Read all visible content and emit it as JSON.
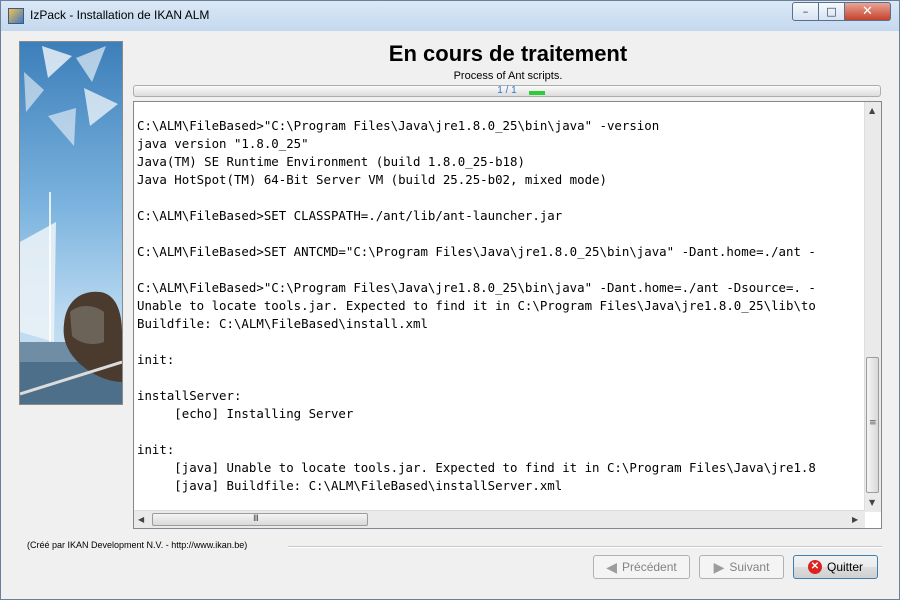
{
  "window": {
    "title": "IzPack - Installation de IKAN ALM",
    "minimize_glyph": "–",
    "maximize_glyph": "□",
    "close_glyph": "✕"
  },
  "panel": {
    "title": "En cours de traitement",
    "subtitle": "Process of Ant scripts."
  },
  "progress": {
    "label": "1 / 1",
    "value": 1,
    "max": 1
  },
  "output": {
    "lines": [
      "C:\\ALM\\FileBased>\"C:\\Program Files\\Java\\jre1.8.0_25\\bin\\java\" -version",
      "java version \"1.8.0_25\"",
      "Java(TM) SE Runtime Environment (build 1.8.0_25-b18)",
      "Java HotSpot(TM) 64-Bit Server VM (build 25.25-b02, mixed mode)",
      "",
      "C:\\ALM\\FileBased>SET CLASSPATH=./ant/lib/ant-launcher.jar",
      "",
      "C:\\ALM\\FileBased>SET ANTCMD=\"C:\\Program Files\\Java\\jre1.8.0_25\\bin\\java\" -Dant.home=./ant -",
      "",
      "C:\\ALM\\FileBased>\"C:\\Program Files\\Java\\jre1.8.0_25\\bin\\java\" -Dant.home=./ant -Dsource=. -",
      "Unable to locate tools.jar. Expected to find it in C:\\Program Files\\Java\\jre1.8.0_25\\lib\\to",
      "Buildfile: C:\\ALM\\FileBased\\install.xml",
      "",
      "init:",
      "",
      "installServer:",
      "     [echo] Installing Server",
      "",
      "init:",
      "     [java] Unable to locate tools.jar. Expected to find it in C:\\Program Files\\Java\\jre1.8",
      "     [java] Buildfile: C:\\ALM\\FileBased\\installServer.xml"
    ],
    "hscroll_grip": "III",
    "vscroll_grip": "≡"
  },
  "footer": {
    "credit": "(Créé par IKAN Development N.V. - http://www.ikan.be)"
  },
  "buttons": {
    "previous": {
      "label": "Précédent",
      "icon": "arrow-left-icon",
      "state": "disabled"
    },
    "next": {
      "label": "Suivant",
      "icon": "arrow-right-icon",
      "state": "disabled"
    },
    "quit": {
      "label": "Quitter",
      "icon": "close-circle-icon",
      "state": "enabled"
    }
  },
  "colors": {
    "progress_fill": "#2fcc3a",
    "progress_text": "#2e78c7",
    "quit_icon": "#d22222",
    "close_button": "#c5422c"
  }
}
